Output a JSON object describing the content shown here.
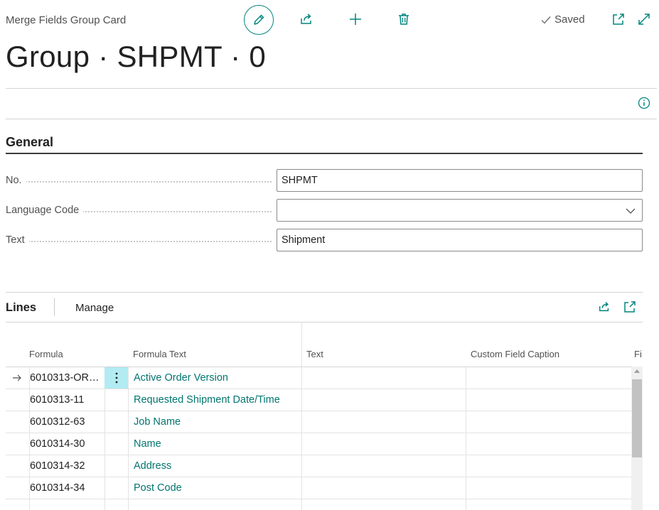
{
  "topbar": {
    "caption": "Merge Fields Group Card",
    "saved_label": "Saved",
    "colors": {
      "accent": "#00857d",
      "link": "#00756f",
      "active_cell": "#b2ebf2"
    }
  },
  "page": {
    "title": "Group · SHPMT · 0"
  },
  "general": {
    "section_title": "General",
    "fields": {
      "no": {
        "label": "No.",
        "value": "SHPMT"
      },
      "language_code": {
        "label": "Language Code",
        "value": ""
      },
      "text": {
        "label": "Text",
        "value": "Shipment"
      }
    }
  },
  "lines": {
    "title": "Lines",
    "manage_label": "Manage",
    "columns": {
      "formula": "Formula",
      "formula_text": "Formula Text",
      "text": "Text",
      "custom_field_caption": "Custom Field Caption",
      "truncated": "Fi"
    },
    "rows": [
      {
        "formula": "6010313-OR…",
        "formula_text": "Active Order Version",
        "current": true
      },
      {
        "formula": "6010313-11",
        "formula_text": "Requested Shipment Date/Time",
        "current": false
      },
      {
        "formula": "6010312-63",
        "formula_text": "Job Name",
        "current": false
      },
      {
        "formula": "6010314-30",
        "formula_text": "Name",
        "current": false
      },
      {
        "formula": "6010314-32",
        "formula_text": "Address",
        "current": false
      },
      {
        "formula": "6010314-34",
        "formula_text": "Post Code",
        "current": false
      }
    ]
  },
  "icons": {
    "edit": "pencil-icon",
    "share": "share-icon",
    "new": "plus-icon",
    "delete": "trash-icon",
    "saved": "checkmark-icon",
    "popout": "popout-icon",
    "expand": "expand-icon",
    "info": "info-icon",
    "row_arrow": "arrow-right-icon",
    "row_menu": "vertical-ellipsis-icon"
  }
}
